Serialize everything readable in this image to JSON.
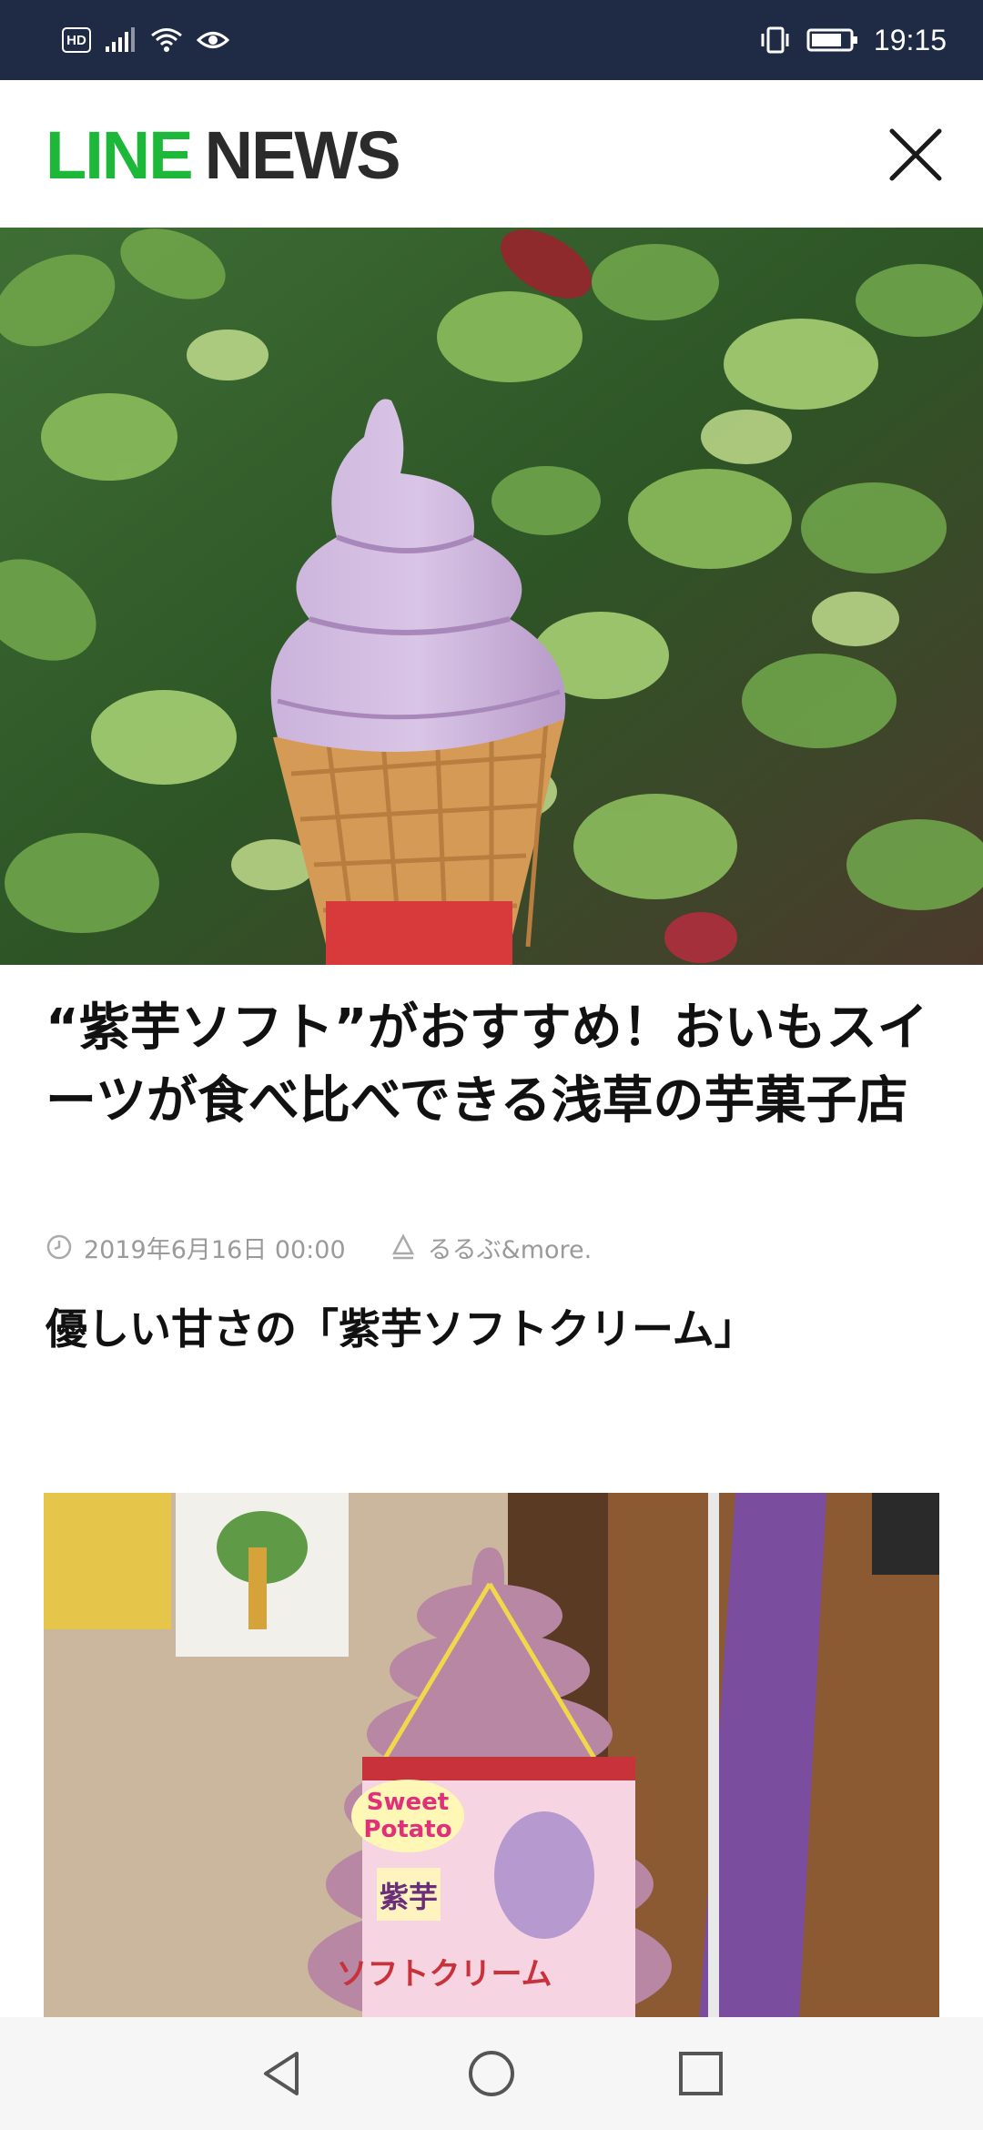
{
  "status_bar": {
    "hd_label": "HD",
    "time": "19:15",
    "icons": [
      "signal-icon",
      "wifi-icon",
      "eye-icon",
      "vibrate-icon",
      "battery-icon"
    ]
  },
  "header": {
    "logo_line": "LINE",
    "logo_news": "NEWS",
    "close_icon": "close-icon",
    "brand_color": "#1db83a"
  },
  "article": {
    "title": "“紫芋ソフト”がおすすめ！おいもスイーツが食べ比べできる浅草の芋菓子店",
    "date": "2019年6月16日 00:00",
    "source": "るるぶ&more.",
    "subheading": "優しい甘さの「紫芋ソフトクリーム」"
  },
  "photo2": {
    "sign_line1": "Sweet",
    "sign_line2": "Potato",
    "sign_label": "紫芋",
    "sign_label2": "ソフトクリーム"
  },
  "nav_bar": {
    "icons": [
      "back-icon",
      "home-icon",
      "recents-icon"
    ]
  }
}
